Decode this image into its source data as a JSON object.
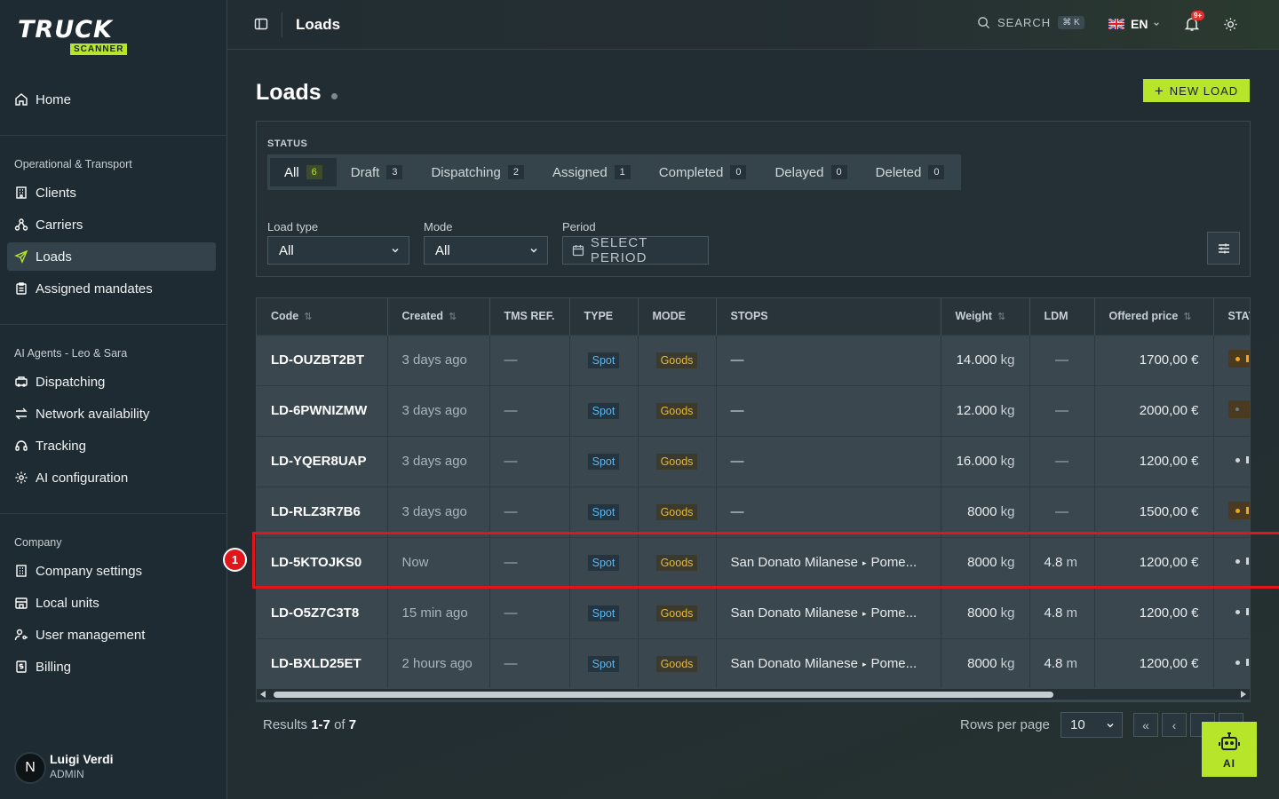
{
  "brand": {
    "name": "TRUCK",
    "sub": "SCANNER",
    "accent": "#b6e52a"
  },
  "sidebar": {
    "home": "Home",
    "sections": [
      {
        "title": "Operational & Transport",
        "items": [
          "Clients",
          "Carriers",
          "Loads",
          "Assigned mandates"
        ]
      },
      {
        "title": "AI Agents - Leo & Sara",
        "items": [
          "Dispatching",
          "Network availability",
          "Tracking",
          "AI configuration"
        ]
      },
      {
        "title": "Company",
        "items": [
          "Company settings",
          "Local units",
          "User management",
          "Billing"
        ]
      }
    ],
    "active": "Loads",
    "user": {
      "initial": "N",
      "name": "Luigi Verdi",
      "role": "ADMIN"
    }
  },
  "topbar": {
    "title": "Loads",
    "search_label": "SEARCH",
    "search_shortcut": "⌘ K",
    "language": "EN",
    "notifications_badge": "9+"
  },
  "page": {
    "title": "Loads",
    "new_load_label": "NEW LOAD"
  },
  "filters": {
    "status_label": "STATUS",
    "statuses": [
      {
        "label": "All",
        "count": "6"
      },
      {
        "label": "Draft",
        "count": "3"
      },
      {
        "label": "Dispatching",
        "count": "2"
      },
      {
        "label": "Assigned",
        "count": "1"
      },
      {
        "label": "Completed",
        "count": "0"
      },
      {
        "label": "Delayed",
        "count": "0"
      },
      {
        "label": "Deleted",
        "count": "0"
      }
    ],
    "load_type_label": "Load type",
    "load_type_value": "All",
    "mode_label": "Mode",
    "mode_value": "All",
    "period_label": "Period",
    "period_placeholder": "SELECT PERIOD"
  },
  "table": {
    "columns": [
      "Code",
      "Created",
      "TMS REF.",
      "TYPE",
      "MODE",
      "STOPS",
      "Weight",
      "LDM",
      "Offered price",
      "STATUS"
    ],
    "rows": [
      {
        "code": "LD-OUZBT2BT",
        "created": "3 days ago",
        "tms": "—",
        "type": "Spot",
        "mode": "Goods",
        "stop_from": "—",
        "stop_to": "",
        "weight": "14.000",
        "ldm": "—",
        "ldm_unit": "",
        "price": "1700,00 €",
        "status": "orange"
      },
      {
        "code": "LD-6PWNIZMW",
        "created": "3 days ago",
        "tms": "—",
        "type": "Spot",
        "mode": "Goods",
        "stop_from": "—",
        "stop_to": "",
        "weight": "12.000",
        "ldm": "—",
        "ldm_unit": "",
        "price": "2000,00 €",
        "status": "dim"
      },
      {
        "code": "LD-YQER8UAP",
        "created": "3 days ago",
        "tms": "—",
        "type": "Spot",
        "mode": "Goods",
        "stop_from": "—",
        "stop_to": "",
        "weight": "16.000",
        "ldm": "—",
        "ldm_unit": "",
        "price": "1200,00 €",
        "status": "grey"
      },
      {
        "code": "LD-RLZ3R7B6",
        "created": "3 days ago",
        "tms": "—",
        "type": "Spot",
        "mode": "Goods",
        "stop_from": "—",
        "stop_to": "",
        "weight": "8000",
        "ldm": "—",
        "ldm_unit": "",
        "price": "1500,00 €",
        "status": "orange"
      },
      {
        "code": "LD-5KTOJKS0",
        "created": "Now",
        "tms": "—",
        "type": "Spot",
        "mode": "Goods",
        "stop_from": "San Donato Milanese",
        "stop_to": "Pome...",
        "weight": "8000",
        "ldm": "4.8",
        "ldm_unit": "m",
        "price": "1200,00 €",
        "status": "grey"
      },
      {
        "code": "LD-O5Z7C3T8",
        "created": "15 min ago",
        "tms": "—",
        "type": "Spot",
        "mode": "Goods",
        "stop_from": "San Donato Milanese",
        "stop_to": "Pome...",
        "weight": "8000",
        "ldm": "4.8",
        "ldm_unit": "m",
        "price": "1200,00 €",
        "status": "grey"
      },
      {
        "code": "LD-BXLD25ET",
        "created": "2 hours ago",
        "tms": "—",
        "type": "Spot",
        "mode": "Goods",
        "stop_from": "San Donato Milanese",
        "stop_to": "Pome...",
        "weight": "8000",
        "ldm": "4.8",
        "ldm_unit": "m",
        "price": "1200,00 €",
        "status": "grey"
      }
    ],
    "weight_unit": "kg"
  },
  "pagination": {
    "results_prefix": "Results",
    "range": "1-7",
    "of": "of",
    "total": "7",
    "rows_per_page_label": "Rows per page",
    "rows_per_page": "10",
    "first": "«",
    "prev": "‹"
  },
  "annotation": {
    "marker": "1"
  },
  "ai_button_label": "AI"
}
